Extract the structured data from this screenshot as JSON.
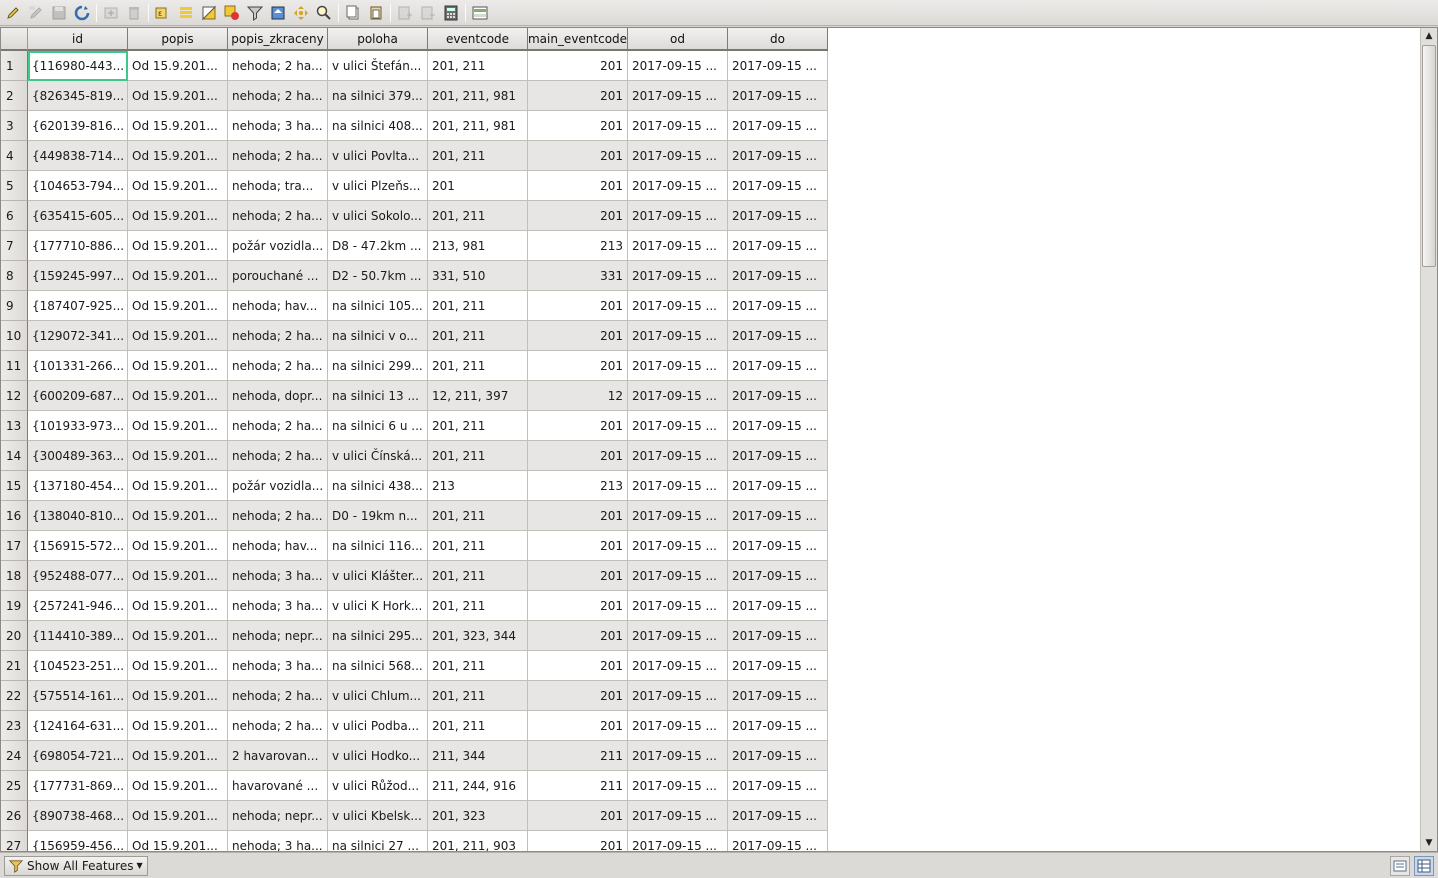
{
  "toolbar": {
    "buttons": [
      {
        "name": "toggle-edit-icon",
        "enabled": true
      },
      {
        "name": "multi-edit-icon",
        "enabled": false
      },
      {
        "name": "save-edits-icon",
        "enabled": false
      },
      {
        "name": "reload-icon",
        "enabled": true
      },
      {
        "name": "add-feature-icon",
        "enabled": false
      },
      {
        "name": "delete-feature-icon",
        "enabled": false
      },
      {
        "name": "select-by-expression-icon",
        "enabled": true
      },
      {
        "name": "select-all-icon",
        "enabled": true
      },
      {
        "name": "invert-selection-icon",
        "enabled": true
      },
      {
        "name": "deselect-all-icon",
        "enabled": true
      },
      {
        "name": "filter-icon",
        "enabled": true
      },
      {
        "name": "move-selection-top-icon",
        "enabled": true
      },
      {
        "name": "pan-to-selection-icon",
        "enabled": true
      },
      {
        "name": "zoom-to-selection-icon",
        "enabled": true
      },
      {
        "name": "copy-rows-icon",
        "enabled": true
      },
      {
        "name": "paste-features-icon",
        "enabled": true
      },
      {
        "name": "new-field-icon",
        "enabled": false
      },
      {
        "name": "delete-field-icon",
        "enabled": false
      },
      {
        "name": "field-calculator-icon",
        "enabled": true
      },
      {
        "name": "conditional-formatting-icon",
        "enabled": true
      }
    ]
  },
  "table": {
    "columns": [
      "id",
      "popis",
      "popis_zkraceny",
      "poloha",
      "eventcode",
      "main_eventcode",
      "od",
      "do"
    ],
    "rows": [
      {
        "n": "1",
        "c": [
          "{116980-443...",
          "Od 15.9.201...",
          "nehoda; 2 ha...",
          "v ulici Štefán...",
          "201, 211",
          "201",
          "2017-09-15 ...",
          "2017-09-15 ..."
        ]
      },
      {
        "n": "2",
        "c": [
          "{826345-819...",
          "Od 15.9.201...",
          "nehoda; 2 ha...",
          "na silnici 379...",
          "201, 211, 981",
          "201",
          "2017-09-15 ...",
          "2017-09-15 ..."
        ]
      },
      {
        "n": "3",
        "c": [
          "{620139-816...",
          "Od 15.9.201...",
          "nehoda; 3 ha...",
          "na silnici 408...",
          "201, 211, 981",
          "201",
          "2017-09-15 ...",
          "2017-09-15 ..."
        ]
      },
      {
        "n": "4",
        "c": [
          "{449838-714...",
          "Od 15.9.201...",
          "nehoda; 2 ha...",
          "v ulici Povlta...",
          "201, 211",
          "201",
          "2017-09-15 ...",
          "2017-09-15 ..."
        ]
      },
      {
        "n": "5",
        "c": [
          "{104653-794...",
          "Od 15.9.201...",
          "nehoda; tra...",
          "v ulici Plzeňs...",
          "201",
          "201",
          "2017-09-15 ...",
          "2017-09-15 ..."
        ]
      },
      {
        "n": "6",
        "c": [
          "{635415-605...",
          "Od 15.9.201...",
          "nehoda; 2 ha...",
          "v ulici Sokolo...",
          "201, 211",
          "201",
          "2017-09-15 ...",
          "2017-09-15 ..."
        ]
      },
      {
        "n": "7",
        "c": [
          "{177710-886...",
          "Od 15.9.201...",
          "požár vozidla...",
          "D8 - 47.2km ...",
          "213, 981",
          "213",
          "2017-09-15 ...",
          "2017-09-15 ..."
        ]
      },
      {
        "n": "8",
        "c": [
          "{159245-997...",
          "Od 15.9.201...",
          "porouchané ...",
          "D2 - 50.7km ...",
          "331, 510",
          "331",
          "2017-09-15 ...",
          "2017-09-15 ..."
        ]
      },
      {
        "n": "9",
        "c": [
          "{187407-925...",
          "Od 15.9.201...",
          "nehoda; hav...",
          "na silnici 105...",
          "201, 211",
          "201",
          "2017-09-15 ...",
          "2017-09-15 ..."
        ]
      },
      {
        "n": "10",
        "c": [
          "{129072-341...",
          "Od 15.9.201...",
          "nehoda; 2 ha...",
          "na silnici v o...",
          "201, 211",
          "201",
          "2017-09-15 ...",
          "2017-09-15 ..."
        ]
      },
      {
        "n": "11",
        "c": [
          "{101331-266...",
          "Od 15.9.201...",
          "nehoda; 2 ha...",
          "na silnici 299...",
          "201, 211",
          "201",
          "2017-09-15 ...",
          "2017-09-15 ..."
        ]
      },
      {
        "n": "12",
        "c": [
          "{600209-687...",
          "Od 15.9.201...",
          "nehoda, dopr...",
          "na silnici 13 ...",
          "12, 211, 397",
          "12",
          "2017-09-15 ...",
          "2017-09-15 ..."
        ]
      },
      {
        "n": "13",
        "c": [
          "{101933-973...",
          "Od 15.9.201...",
          "nehoda; 2 ha...",
          "na silnici 6 u ...",
          "201, 211",
          "201",
          "2017-09-15 ...",
          "2017-09-15 ..."
        ]
      },
      {
        "n": "14",
        "c": [
          "{300489-363...",
          "Od 15.9.201...",
          "nehoda; 2 ha...",
          "v ulici Čínská...",
          "201, 211",
          "201",
          "2017-09-15 ...",
          "2017-09-15 ..."
        ]
      },
      {
        "n": "15",
        "c": [
          "{137180-454...",
          "Od 15.9.201...",
          "požár vozidla...",
          "na silnici 438...",
          "213",
          "213",
          "2017-09-15 ...",
          "2017-09-15 ..."
        ]
      },
      {
        "n": "16",
        "c": [
          "{138040-810...",
          "Od 15.9.201...",
          "nehoda; 2 ha...",
          "D0 - 19km n...",
          "201, 211",
          "201",
          "2017-09-15 ...",
          "2017-09-15 ..."
        ]
      },
      {
        "n": "17",
        "c": [
          "{156915-572...",
          "Od 15.9.201...",
          "nehoda; hav...",
          "na silnici 116...",
          "201, 211",
          "201",
          "2017-09-15 ...",
          "2017-09-15 ..."
        ]
      },
      {
        "n": "18",
        "c": [
          "{952488-077...",
          "Od 15.9.201...",
          "nehoda; 3 ha...",
          "v ulici Klášter...",
          "201, 211",
          "201",
          "2017-09-15 ...",
          "2017-09-15 ..."
        ]
      },
      {
        "n": "19",
        "c": [
          "{257241-946...",
          "Od 15.9.201...",
          "nehoda; 3 ha...",
          "v ulici K Hork...",
          "201, 211",
          "201",
          "2017-09-15 ...",
          "2017-09-15 ..."
        ]
      },
      {
        "n": "20",
        "c": [
          "{114410-389...",
          "Od 15.9.201...",
          "nehoda; nepr...",
          "na silnici 295...",
          "201, 323, 344",
          "201",
          "2017-09-15 ...",
          "2017-09-15 ..."
        ]
      },
      {
        "n": "21",
        "c": [
          "{104523-251...",
          "Od 15.9.201...",
          "nehoda; 3 ha...",
          "na silnici 568...",
          "201, 211",
          "201",
          "2017-09-15 ...",
          "2017-09-15 ..."
        ]
      },
      {
        "n": "22",
        "c": [
          "{575514-161...",
          "Od 15.9.201...",
          "nehoda; 2 ha...",
          "v ulici Chlum...",
          "201, 211",
          "201",
          "2017-09-15 ...",
          "2017-09-15 ..."
        ]
      },
      {
        "n": "23",
        "c": [
          "{124164-631...",
          "Od 15.9.201...",
          "nehoda; 2 ha...",
          "v ulici Podba...",
          "201, 211",
          "201",
          "2017-09-15 ...",
          "2017-09-15 ..."
        ]
      },
      {
        "n": "24",
        "c": [
          "{698054-721...",
          "Od 15.9.201...",
          "2 havarovan...",
          "v ulici Hodko...",
          "211, 344",
          "211",
          "2017-09-15 ...",
          "2017-09-15 ..."
        ]
      },
      {
        "n": "25",
        "c": [
          "{177731-869...",
          "Od 15.9.201...",
          "havarované ...",
          "v ulici Růžod...",
          "211, 244, 916",
          "211",
          "2017-09-15 ...",
          "2017-09-15 ..."
        ]
      },
      {
        "n": "26",
        "c": [
          "{890738-468...",
          "Od 15.9.201...",
          "nehoda; nepr...",
          "v ulici Kbelsk...",
          "201, 323",
          "201",
          "2017-09-15 ...",
          "2017-09-15 ..."
        ]
      },
      {
        "n": "27",
        "c": [
          "{156959-456...",
          "Od 15.9.201...",
          "nehoda; 3 ha...",
          "na silnici 27 ...",
          "201, 211, 903",
          "201",
          "2017-09-15 ...",
          "2017-09-15 ..."
        ]
      }
    ]
  },
  "footer": {
    "filter_label": "Show All Features"
  }
}
